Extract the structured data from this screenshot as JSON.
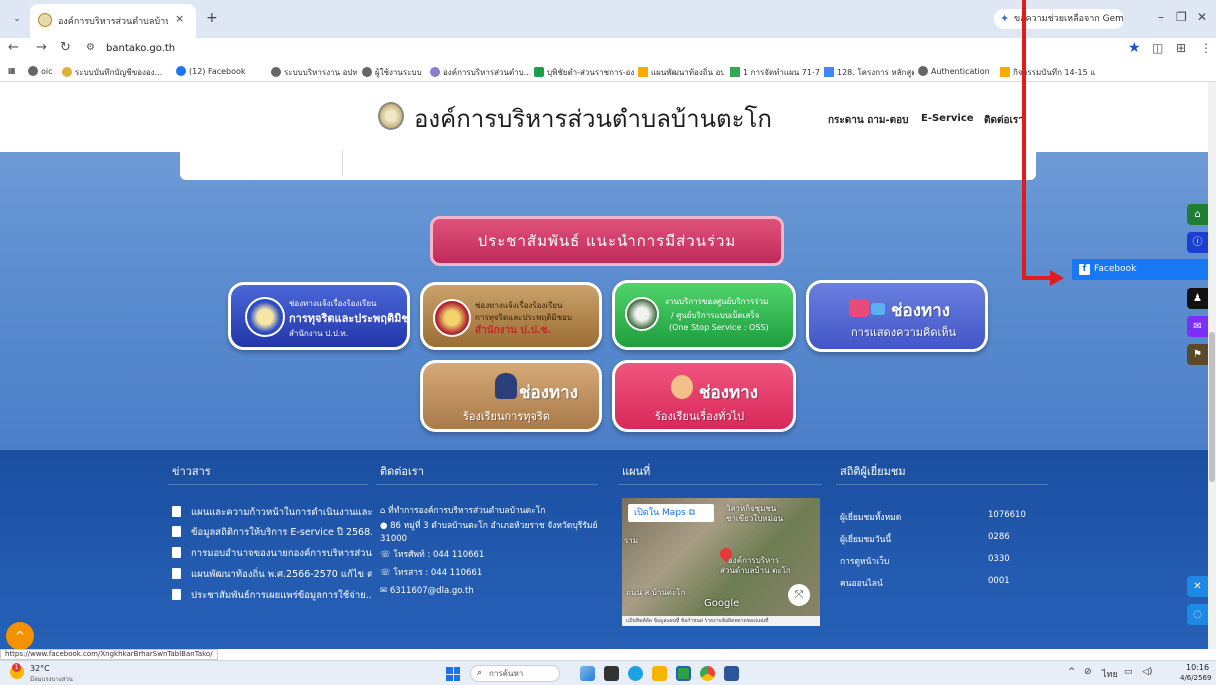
{
  "browser": {
    "tab_title": "องค์การบริหารส่วนตำบลบ้านตะโก",
    "tab_close": "×",
    "new_tab": "+",
    "tab_menu": "⌄",
    "gemini_label": "ขอความช่วยเหลือจาก Gemini",
    "window_controls": [
      "–",
      "❐",
      "✕"
    ],
    "url": "bantako.go.th",
    "bookmarks": [
      "oic",
      "ระบบบันทึกบัญชีขององ...",
      "(12) Facebook",
      "ระบบบริหารงาน อปท.",
      "ผู้ใช้งานระบบ",
      "องค์การบริหารส่วนตำบ...",
      "บุพิชัยตำ-ส่วนราชการ-องค์การ...",
      "แผนพัฒนาท้องถิ่น อบต...",
      "1 การจัดทำแผน 71-75...",
      "128. โครงการ หลักสูตร...",
      "Authentication",
      "กิจกรรมบันทึก 14-15 แ..."
    ]
  },
  "site": {
    "title": "องค์การบริหารส่วนตำบลบ้านตะโก",
    "nav": [
      "กระดาน ถาม-ตอบ",
      "E-Service",
      "ติดต่อเรา"
    ],
    "pr_banner": "ประชาสัมพันธ์ แนะนำการมีส่วนร่วม",
    "services": {
      "nacc": {
        "line1": "ช่องทางแจ้งเรื่องร้องเรียน",
        "line2": "การทุจริตและประพฤติมิชอบ",
        "line3": "สำนักงาน ป.ป.ท."
      },
      "pacc": {
        "line1": "ช่องทางแจ้งเรื่องร้องเรียน",
        "line2": "การทุจริตและประพฤติมิชอบ",
        "line3": "สำนักงาน ป.ป.ช."
      },
      "oss": {
        "line1": "งานบริการของศูนย์บริการร่วม",
        "line2": "/ ศูนย์บริการแบบเบ็ดเสร็จ",
        "line3": "(One Stop Service : OSS)"
      },
      "opinion": {
        "big": "ช่องทาง",
        "sub": "การแสดงความคิดเห็น"
      },
      "corruption": {
        "big": "ช่องทาง",
        "sub": "ร้องเรียนการทุจริต"
      },
      "general": {
        "big": "ช่องทาง",
        "sub": "ร้องเรียนเรื่องทั่วไป"
      }
    }
  },
  "footer": {
    "news_heading": "ข่าวสาร",
    "news": [
      "แผนและความก้าวหน้าในการดำเนินงานและ...",
      "ข้อมูลสถิติการให้บริการ E-service ปี 2568...",
      "การมอบอำนาจของนายกองค์การบริหารส่วน...",
      "แผนพัฒนาท้องถิ่น พ.ศ.2566-2570 แก้ไข ค...",
      "ประชาสัมพันธ์การเผยแพร่ข้อมูลการใช้จ่าย..."
    ],
    "contact_heading": "ติดต่อเรา",
    "contact": {
      "office": "ที่ทำการองค์การบริหารส่วนตำบลบ้านตะโก",
      "address": "86 หมู่ที่ 3 ตำบลบ้านตะโก อำเภอห้วยราช จังหวัดบุรีรัมย์ 31000",
      "phone": "โทรศัพท์ : 044 110661",
      "fax": "โทรสาร : 044 110661",
      "email": "6311607@dla.go.th"
    },
    "map_heading": "แผนที่",
    "map": {
      "open_button": "เปิดใน Maps",
      "label1": "วิสาหกิจชุมชน",
      "label2": "ชาเขียวใบหม่อน",
      "label3": "องค์การบริหาร",
      "label4": "ส่วนตำบลบ้าน ตะโก",
      "label5": "ถนน ส.บ้านตะโก",
      "label6": "ราม",
      "google": "Google",
      "foot": "แป้นพิมพ์ลัด   ข้อมูลแผนที่   ข้อกำหนด   รายงานข้อผิดพลาดของแผนที่"
    },
    "stats_heading": "สถิติผู้เยี่ยมชม",
    "stats": [
      {
        "label": "ผู้เยี่ยมชมทั้งหมด",
        "value": "1076610"
      },
      {
        "label": "ผู้เยี่ยมชมวันนี้",
        "value": "0286"
      },
      {
        "label": "การดูหน้าเว็บ",
        "value": "0330"
      },
      {
        "label": "คนออนไลน์",
        "value": "0001"
      }
    ]
  },
  "floaters": {
    "facebook": "Facebook",
    "side_colors": [
      "#1e7e34",
      "#1a3fd1",
      "#111111",
      "#7b2ff7",
      "#5a4a2a",
      "#1e88e5",
      "#1e88e5"
    ],
    "up": "^"
  },
  "status_url": "https://www.facebook.com/XngkhkarBrharSwnTablBanTako/",
  "taskbar": {
    "temp": "32°C",
    "weather": "มีลมแรงบางส่วน",
    "search": "การค้นหา",
    "lang": "ไทย",
    "time": "10:16",
    "date": "4/6/2569"
  }
}
